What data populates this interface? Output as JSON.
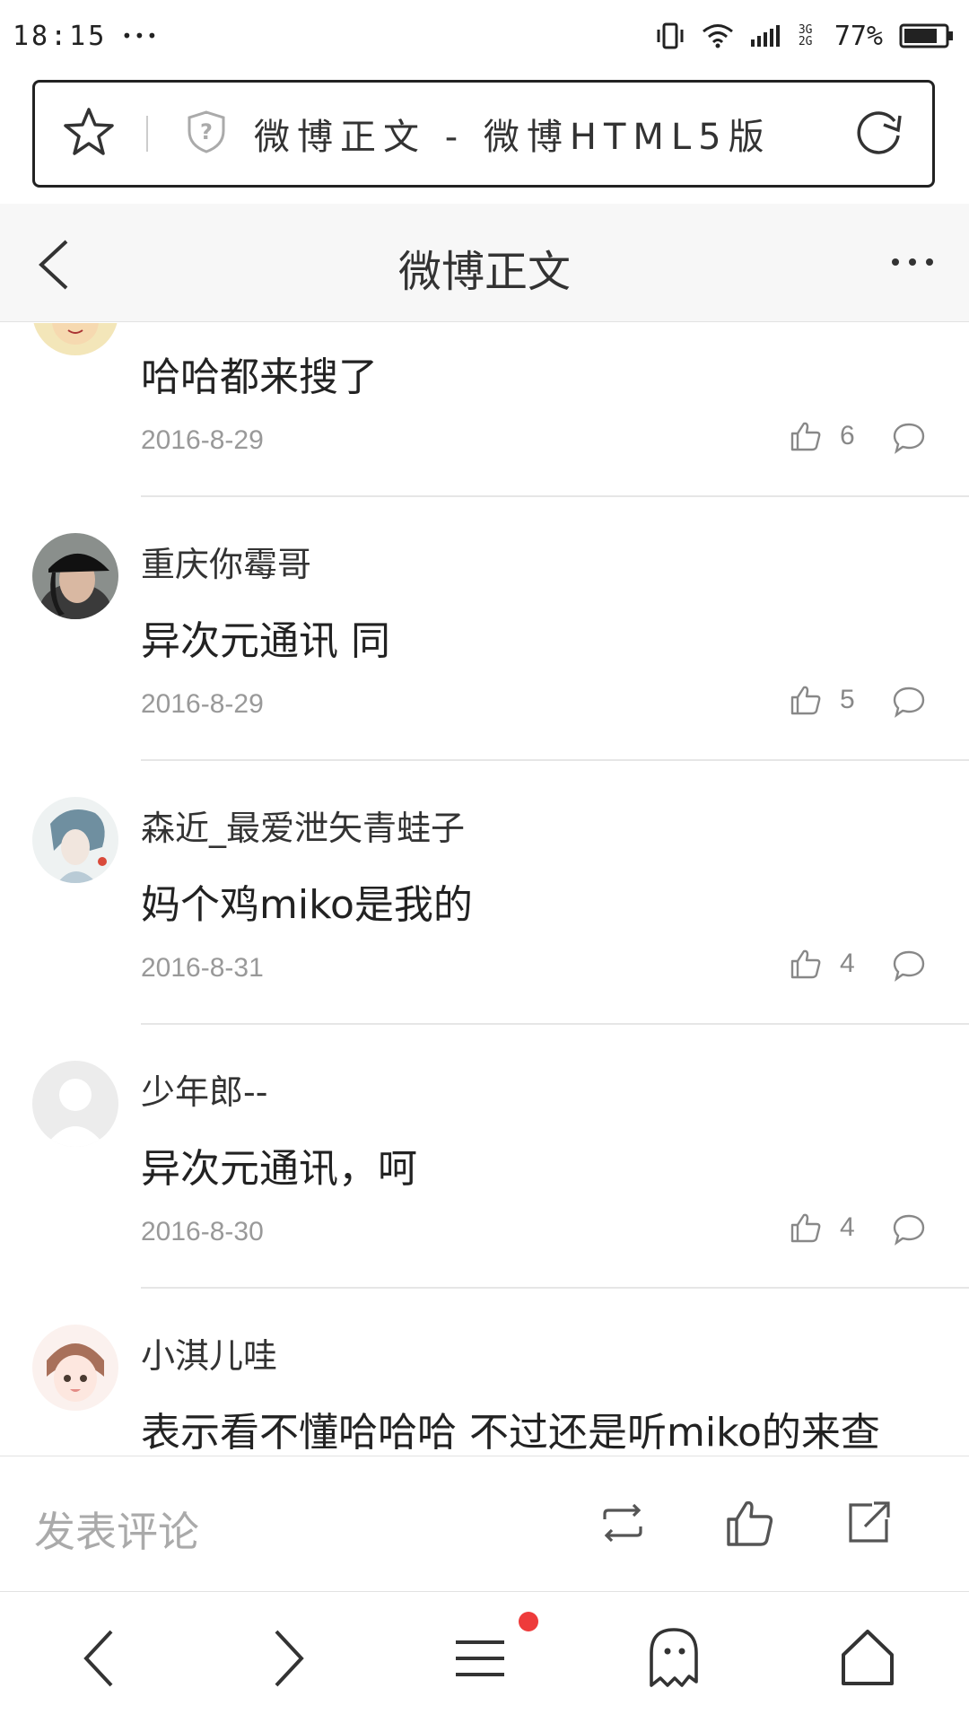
{
  "status_bar": {
    "time": "18:15",
    "dots": "•••",
    "network": "3G 2G",
    "battery": "77%"
  },
  "address_bar": {
    "page_title": "微博正文 - 微博HTML5版"
  },
  "header": {
    "title": "微博正文"
  },
  "comments": [
    {
      "username": "",
      "text": "哈哈都来搜了",
      "date": "2016-8-29",
      "likes": "6"
    },
    {
      "username": "重庆你霉哥",
      "text": "异次元通讯 同",
      "date": "2016-8-29",
      "likes": "5"
    },
    {
      "username": "森近_最爱泄矢青蛙子",
      "text": "妈个鸡miko是我的",
      "date": "2016-8-31",
      "likes": "4"
    },
    {
      "username": "少年郎--",
      "text": "异次元通讯，呵",
      "date": "2016-8-30",
      "likes": "4"
    },
    {
      "username": "小淇儿哇",
      "text": "表示看不懂哈哈哈 不过还是听miko的来查",
      "date": "",
      "likes": ""
    }
  ],
  "comment_bar": {
    "placeholder": "发表评论"
  },
  "colors": {
    "notification_dot": "#ee3b3b",
    "meta_text": "#999999"
  }
}
